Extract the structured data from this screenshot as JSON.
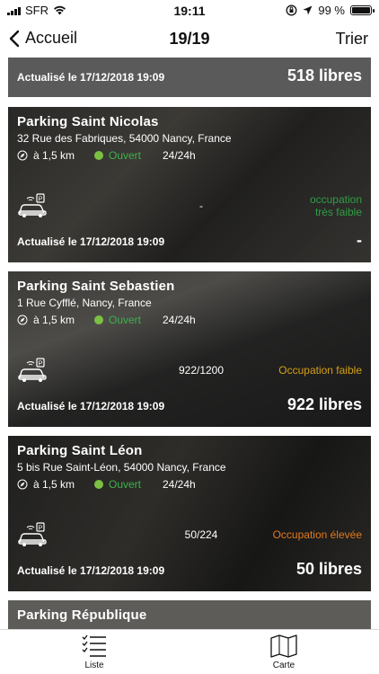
{
  "status": {
    "carrier": "SFR",
    "time": "19:11",
    "battery": "99 %",
    "battery_level": 0.99
  },
  "nav": {
    "back_label": "Accueil",
    "title": "19/19",
    "sort_label": "Trier"
  },
  "cards": [
    {
      "name": "",
      "updated": "Actualisé le 17/12/2018 19:09",
      "free": "518 libres"
    },
    {
      "name": "Parking Saint Nicolas",
      "address": "32 Rue des Fabriques, 54000 Nancy, France",
      "distance": "à 1,5 km",
      "status": "Ouvert",
      "hours": "24/24h",
      "count": "-",
      "level_line1": "occupation",
      "level_line2": "très faible",
      "level_color": "#2f9e44",
      "updated": "Actualisé le 17/12/2018 19:09",
      "free": "-"
    },
    {
      "name": "Parking Saint Sebastien",
      "address": "1 Rue Cyfflé, Nancy, France",
      "distance": "à 1,5 km",
      "status": "Ouvert",
      "hours": "24/24h",
      "count": "922/1200",
      "level_line1": "Occupation faible",
      "level_line2": "",
      "level_color": "#d4a017",
      "updated": "Actualisé le 17/12/2018 19:09",
      "free": "922 libres"
    },
    {
      "name": "Parking Saint Léon",
      "address": "5 bis Rue Saint-Léon, 54000 Nancy, France",
      "distance": "à 1,5 km",
      "status": "Ouvert",
      "hours": "24/24h",
      "count": "50/224",
      "level_line1": "Occupation élevée",
      "level_line2": "",
      "level_color": "#e07a1f",
      "updated": "Actualisé le 17/12/2018 19:09",
      "free": "50 libres"
    },
    {
      "name": "Parking République"
    }
  ],
  "tabs": [
    {
      "label": "Liste",
      "icon": "list-icon"
    },
    {
      "label": "Carte",
      "icon": "map-icon"
    }
  ]
}
